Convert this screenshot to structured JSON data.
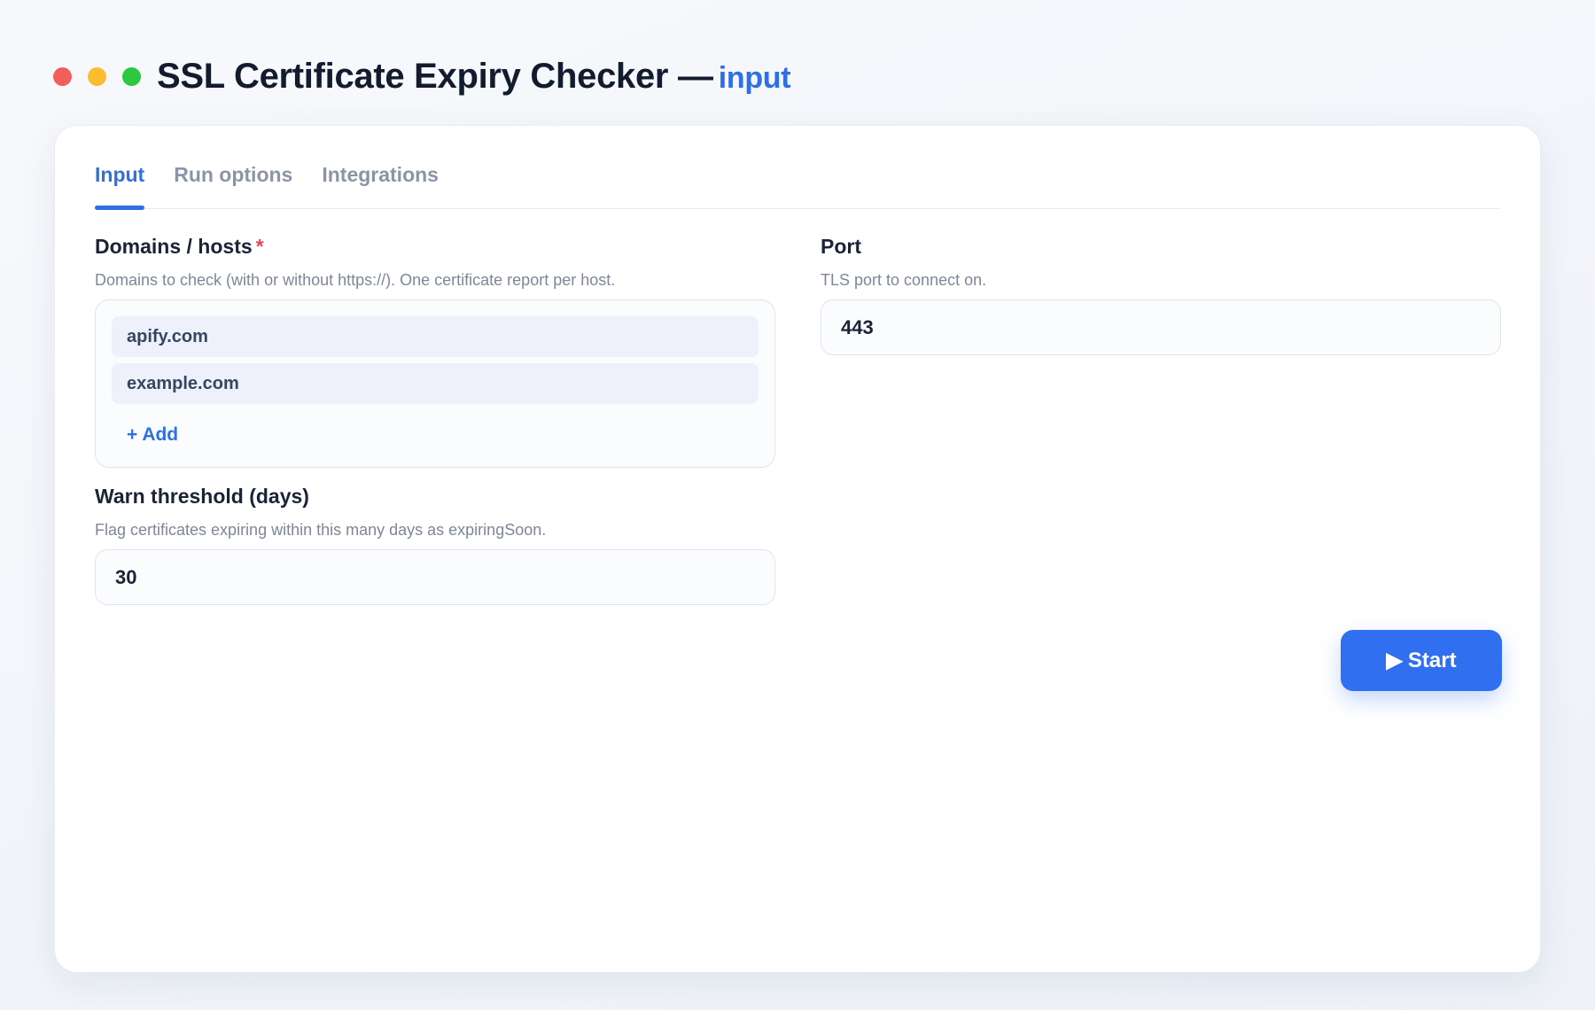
{
  "window": {
    "title": "SSL Certificate Expiry Checker —",
    "title_accent": "input",
    "controls": [
      "close",
      "minimize",
      "maximize"
    ]
  },
  "tabs": [
    {
      "label": "Input",
      "active": true
    },
    {
      "label": "Run options",
      "active": false
    },
    {
      "label": "Integrations",
      "active": false
    }
  ],
  "domains": {
    "label": "Domains / hosts",
    "required_mark": "*",
    "help": "Domains to check (with or without https://). One certificate report per host.",
    "items": [
      "apify.com",
      "example.com"
    ],
    "add_label": "+ Add"
  },
  "port": {
    "label": "Port",
    "help": "TLS port to connect on.",
    "value": "443"
  },
  "warn_threshold": {
    "label": "Warn threshold (days)",
    "help": "Flag certificates expiring within this many days as expiringSoon.",
    "value": "30"
  },
  "start_button": {
    "icon": "play-icon",
    "glyph": "▶",
    "label": "Start"
  },
  "colors": {
    "accent": "#2f6fe4",
    "required": "#e5484d",
    "close": "#f25f58",
    "minimize": "#fbbc2e",
    "maximize": "#2ec840"
  }
}
